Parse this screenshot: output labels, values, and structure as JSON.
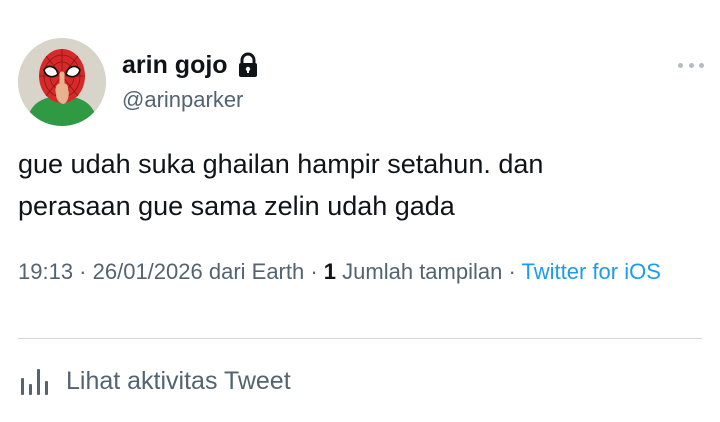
{
  "author": {
    "display_name": "arin gojo",
    "handle": "@arinparker",
    "avatar_icon": "spiderman-mask-avatar",
    "protected_icon": "lock-icon"
  },
  "tweet": {
    "text": "gue udah suka ghailan hampir setahun. dan\nperasaan gue sama zelin udah gada"
  },
  "meta": {
    "time": "19:13",
    "sep1": " · ",
    "date": "26/01/2026",
    "location": " dari Earth",
    "sep2": " · ",
    "views_count": "1",
    "views_label": " Jumlah tampilan",
    "sep3": " · ",
    "source": "Twitter for iOS"
  },
  "actions": {
    "activity_label": "Lihat aktivitas Tweet",
    "more_icon": "more-options-icon",
    "activity_icon": "analytics-bar-chart-icon"
  },
  "colors": {
    "text_primary": "#0f1419",
    "text_secondary": "#536471",
    "link": "#1d9bf0",
    "divider": "#cfd9de"
  }
}
